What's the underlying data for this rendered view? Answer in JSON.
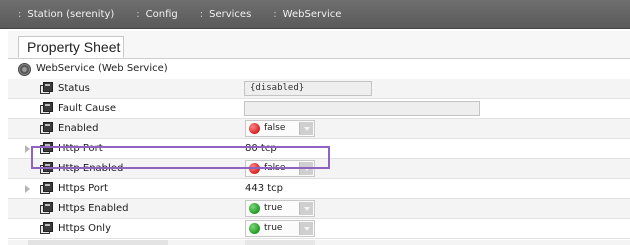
{
  "breadcrumb": [
    {
      "label": "Station (serenity)"
    },
    {
      "label": "Config"
    },
    {
      "label": "Services"
    },
    {
      "label": "WebService"
    }
  ],
  "tab": {
    "label": "Property Sheet"
  },
  "root": {
    "label": "WebService  (Web Service)"
  },
  "properties": [
    {
      "name": "Status",
      "value": "{disabled}"
    },
    {
      "name": "Fault Cause",
      "value": ""
    },
    {
      "name": "Enabled",
      "value": "false",
      "state": "red"
    },
    {
      "name": "Http Port",
      "value": "80 tcp"
    },
    {
      "name": "Http Enabled",
      "value": "false",
      "state": "red"
    },
    {
      "name": "Https Port",
      "value": "443 tcp"
    },
    {
      "name": "Https Enabled",
      "value": "true",
      "state": "green"
    },
    {
      "name": "Https Only",
      "value": "true",
      "state": "green"
    }
  ],
  "colors": {
    "highlight": "#8e63c2",
    "false_dot": "#d61f1f",
    "true_dot": "#1f9a1f"
  }
}
